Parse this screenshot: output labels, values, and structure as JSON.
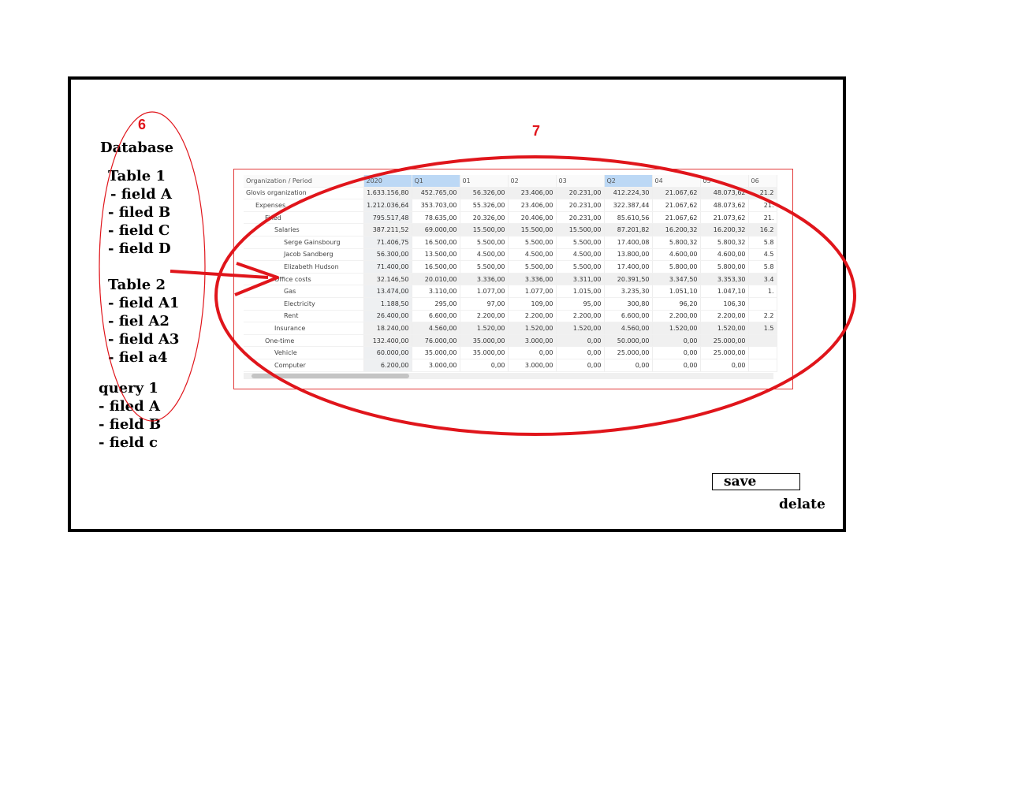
{
  "annotations": {
    "left_number": "6",
    "right_number": "7",
    "color": "#e0151b"
  },
  "database": {
    "title": "Database",
    "tables": [
      {
        "name": "Table 1",
        "fields": [
          "- field A",
          "- filed B",
          "- field C",
          "- field D"
        ]
      },
      {
        "name": "Table 2",
        "fields": [
          "- field A1",
          "- fiel A2",
          "- field A3",
          "- fiel a4"
        ]
      }
    ],
    "query": {
      "name": "query 1",
      "fields": [
        "- filed A",
        "- field B",
        "- field c"
      ]
    }
  },
  "pivot": {
    "headers": [
      "Organization / Period",
      "2020",
      "Q1",
      "01",
      "02",
      "03",
      "Q2",
      "04",
      "05",
      "06"
    ],
    "selected_header_indexes": [
      1,
      2,
      6
    ],
    "rows": [
      {
        "label": "Glovis organization",
        "values": [
          "1.633.156,80",
          "452.765,00",
          "56.326,00",
          "23.406,00",
          "20.231,00",
          "412.224,30",
          "21.067,62",
          "48.073,62",
          "21.2"
        ]
      },
      {
        "label": "Expenses",
        "values": [
          "1.212.036,64",
          "353.703,00",
          "55.326,00",
          "23.406,00",
          "20.231,00",
          "322.387,44",
          "21.067,62",
          "48.073,62",
          "21."
        ]
      },
      {
        "label": "Fixed",
        "values": [
          "795.517,48",
          "78.635,00",
          "20.326,00",
          "20.406,00",
          "20.231,00",
          "85.610,56",
          "21.067,62",
          "21.073,62",
          "21."
        ]
      },
      {
        "label": "Salaries",
        "values": [
          "387.211,52",
          "69.000,00",
          "15.500,00",
          "15.500,00",
          "15.500,00",
          "87.201,82",
          "16.200,32",
          "16.200,32",
          "16.2"
        ]
      },
      {
        "label": "Serge Gainsbourg",
        "values": [
          "71.406,75",
          "16.500,00",
          "5.500,00",
          "5.500,00",
          "5.500,00",
          "17.400,08",
          "5.800,32",
          "5.800,32",
          "5.8"
        ]
      },
      {
        "label": "Jacob Sandberg",
        "values": [
          "56.300,00",
          "13.500,00",
          "4.500,00",
          "4.500,00",
          "4.500,00",
          "13.800,00",
          "4.600,00",
          "4.600,00",
          "4.5"
        ]
      },
      {
        "label": "Elizabeth Hudson",
        "values": [
          "71.400,00",
          "16.500,00",
          "5.500,00",
          "5.500,00",
          "5.500,00",
          "17.400,00",
          "5.800,00",
          "5.800,00",
          "5.8"
        ]
      },
      {
        "label": "Office costs",
        "values": [
          "32.146,50",
          "20.010,00",
          "3.336,00",
          "3.336,00",
          "3.311,00",
          "20.391,50",
          "3.347,50",
          "3.353,30",
          "3.4"
        ]
      },
      {
        "label": "Gas",
        "values": [
          "13.474,00",
          "3.110,00",
          "1.077,00",
          "1.077,00",
          "1.015,00",
          "3.235,30",
          "1.051,10",
          "1.047,10",
          "1."
        ]
      },
      {
        "label": "Electricity",
        "values": [
          "1.188,50",
          "295,00",
          "97,00",
          "109,00",
          "95,00",
          "300,80",
          "96,20",
          "106,30",
          ""
        ]
      },
      {
        "label": "Rent",
        "values": [
          "26.400,00",
          "6.600,00",
          "2.200,00",
          "2.200,00",
          "2.200,00",
          "6.600,00",
          "2.200,00",
          "2.200,00",
          "2.2"
        ]
      },
      {
        "label": "Insurance",
        "values": [
          "18.240,00",
          "4.560,00",
          "1.520,00",
          "1.520,00",
          "1.520,00",
          "4.560,00",
          "1.520,00",
          "1.520,00",
          "1.5"
        ]
      },
      {
        "label": "One-time",
        "values": [
          "132.400,00",
          "76.000,00",
          "35.000,00",
          "3.000,00",
          "0,00",
          "50.000,00",
          "0,00",
          "25.000,00",
          ""
        ]
      },
      {
        "label": "Vehicle",
        "values": [
          "60.000,00",
          "35.000,00",
          "35.000,00",
          "0,00",
          "0,00",
          "25.000,00",
          "0,00",
          "25.000,00",
          ""
        ]
      },
      {
        "label": "Computer",
        "values": [
          "6.200,00",
          "3.000,00",
          "0,00",
          "3.000,00",
          "0,00",
          "0,00",
          "0,00",
          "0,00",
          ""
        ]
      }
    ]
  },
  "actions": {
    "save_label": "save",
    "delete_label": "delate"
  }
}
